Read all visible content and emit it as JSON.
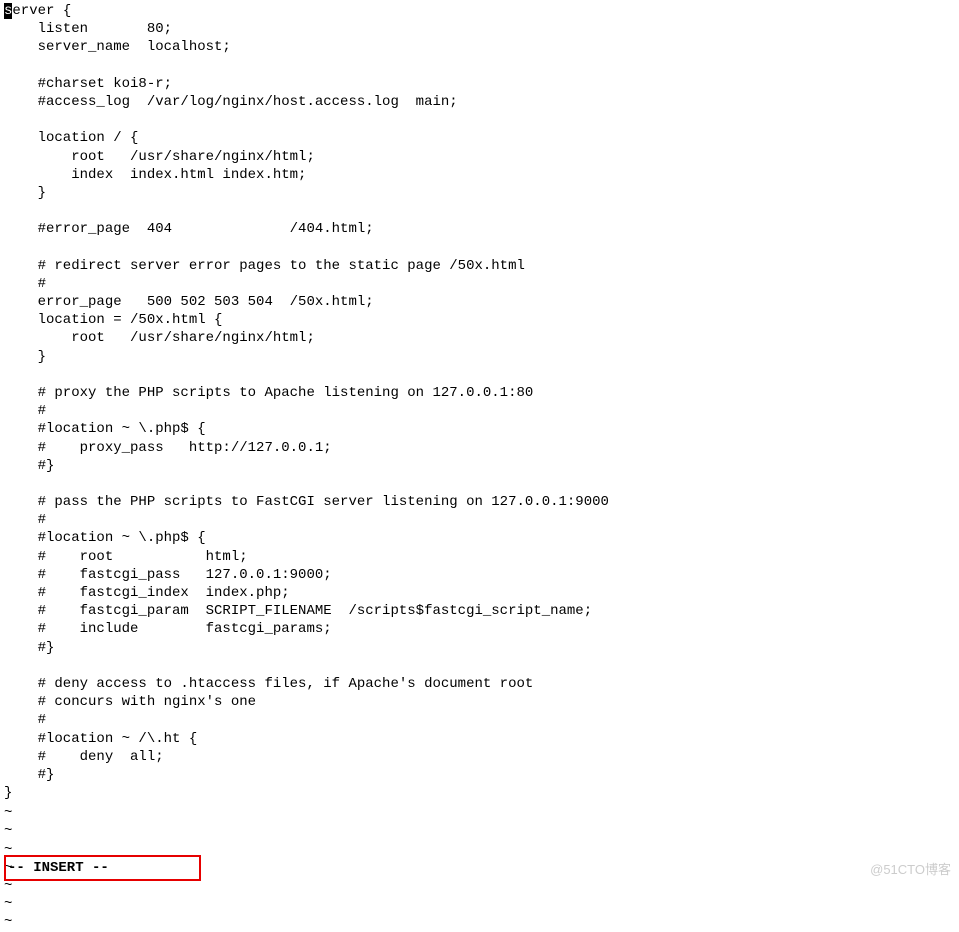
{
  "editor": {
    "cursor_char": "s",
    "lines": [
      "erver {",
      "    listen       80;",
      "    server_name  localhost;",
      "",
      "    #charset koi8-r;",
      "    #access_log  /var/log/nginx/host.access.log  main;",
      "",
      "    location / {",
      "        root   /usr/share/nginx/html;",
      "        index  index.html index.htm;",
      "    }",
      "",
      "    #error_page  404              /404.html;",
      "",
      "    # redirect server error pages to the static page /50x.html",
      "    #",
      "    error_page   500 502 503 504  /50x.html;",
      "    location = /50x.html {",
      "        root   /usr/share/nginx/html;",
      "    }",
      "",
      "    # proxy the PHP scripts to Apache listening on 127.0.0.1:80",
      "    #",
      "    #location ~ \\.php$ {",
      "    #    proxy_pass   http://127.0.0.1;",
      "    #}",
      "",
      "    # pass the PHP scripts to FastCGI server listening on 127.0.0.1:9000",
      "    #",
      "    #location ~ \\.php$ {",
      "    #    root           html;",
      "    #    fastcgi_pass   127.0.0.1:9000;",
      "    #    fastcgi_index  index.php;",
      "    #    fastcgi_param  SCRIPT_FILENAME  /scripts$fastcgi_script_name;",
      "    #    include        fastcgi_params;",
      "    #}",
      "",
      "    # deny access to .htaccess files, if Apache's document root",
      "    # concurs with nginx's one",
      "    #",
      "    #location ~ /\\.ht {",
      "    #    deny  all;",
      "    #}",
      "}",
      ""
    ],
    "tildes": [
      "~",
      "~",
      "~",
      "~",
      "~",
      "~",
      "~"
    ]
  },
  "status": {
    "mode": "-- INSERT --"
  },
  "watermark": "@51CTO博客"
}
